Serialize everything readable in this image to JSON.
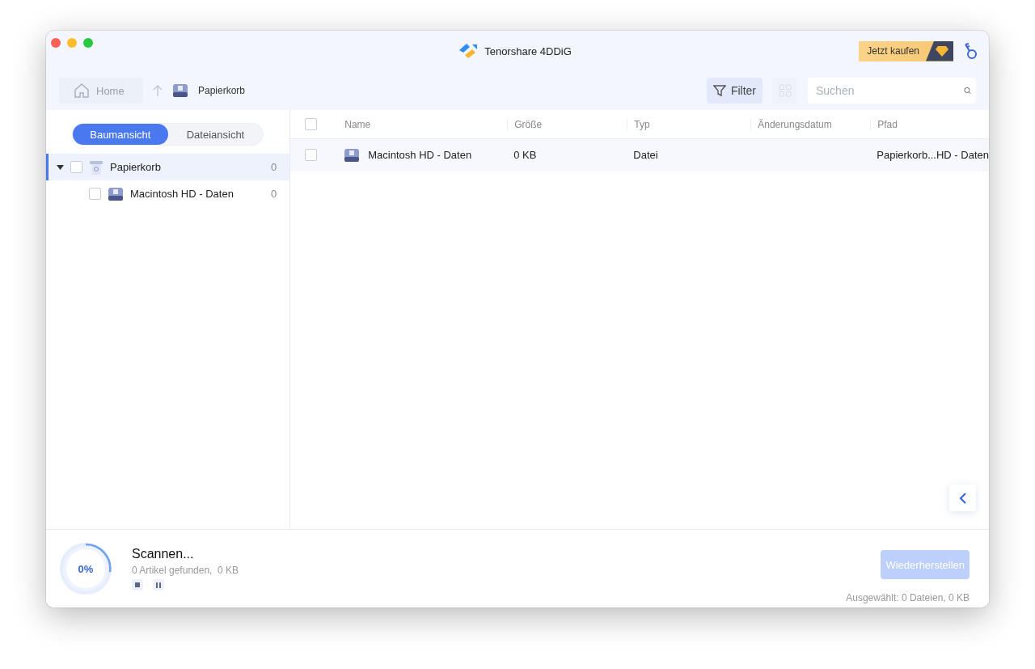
{
  "window": {
    "title": "Tenorshare 4DDiG"
  },
  "buy_button": {
    "label": "Jetzt kaufen"
  },
  "breadcrumb": {
    "home": "Home",
    "current": "Papierkorb"
  },
  "toolbar": {
    "filter": "Filter",
    "grid_view_disabled": true,
    "search": {
      "placeholder": "Suchen"
    }
  },
  "view_toggle": [
    {
      "label": "Baumansicht",
      "selected": true
    },
    {
      "label": "Dateiansicht",
      "selected": false
    }
  ],
  "tree": [
    {
      "label": "Papierkorb",
      "count": "0",
      "checked": false,
      "expanded": true,
      "selected": true,
      "kind": "trash",
      "children": [
        {
          "label": "Macintosh HD - Daten",
          "count": "0",
          "checked": false,
          "selected": false,
          "kind": "disk"
        }
      ]
    }
  ],
  "table": {
    "columns": [
      "Name",
      "Größe",
      "Typ",
      "Änderungsdatum",
      "Pfad"
    ],
    "all_checked": false,
    "rows": [
      {
        "checked": false,
        "name": "Macintosh HD - Daten",
        "size": "0 KB",
        "type": "Datei",
        "path": "Papierkorb...HD - Daten"
      }
    ]
  },
  "footer": {
    "progress": {
      "label": "0%",
      "level": 0
    },
    "status": "Scannen...",
    "found": "0 Artikel gefunden,  0 KB",
    "restore": {
      "label": "Wiederherstellen",
      "disabled": true
    },
    "selection": "Ausgewählt: 0 Dateien, 0 KB"
  }
}
